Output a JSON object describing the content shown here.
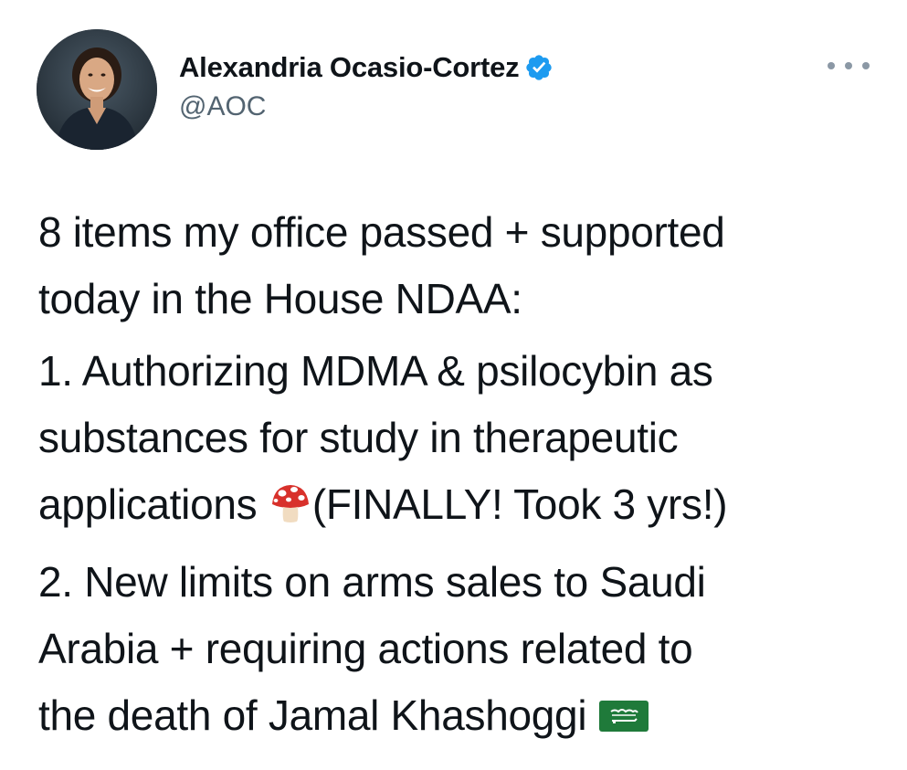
{
  "tweet": {
    "author": {
      "display_name": "Alexandria Ocasio-Cortez",
      "handle": "@AOC",
      "verified": true,
      "verified_color": "#1d9bf0",
      "avatar_icon": "profile-photo"
    },
    "more_menu_icon": "more-dots-icon",
    "body": {
      "intro_line1": "8 items my office passed + supported",
      "intro_line2": "today in the House NDAA:",
      "item1_line1": "1. Authorizing MDMA & psilocybin as",
      "item1_line2": "substances for study in therapeutic",
      "item1_line3_prefix": "applications ",
      "item1_emoji": "mushroom-icon",
      "item1_line3_suffix": "(FINALLY! Took 3 yrs!)",
      "item2_line1": "2. New limits on arms sales to Saudi",
      "item2_line2": "Arabia + requiring actions related to",
      "item2_line3_prefix": "the death of Jamal Khashoggi ",
      "item2_emoji": "saudi-flag-icon"
    }
  }
}
